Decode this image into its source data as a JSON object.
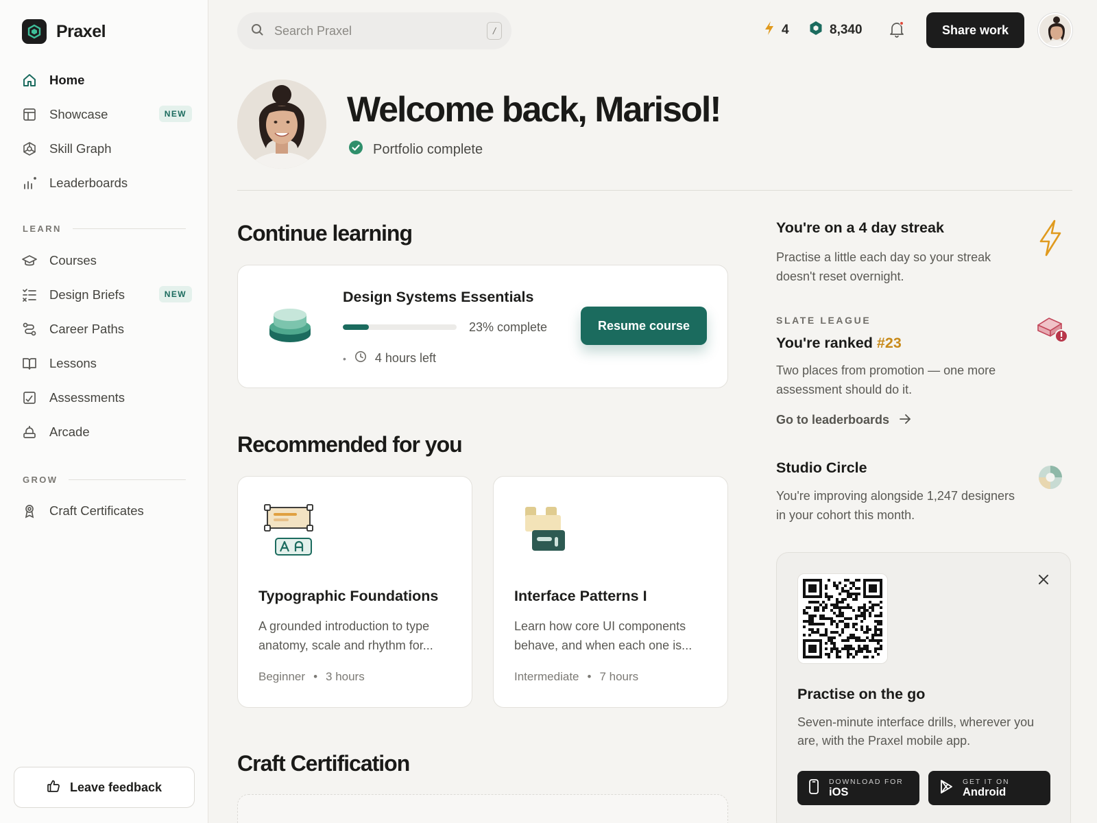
{
  "brand": {
    "name": "Praxel"
  },
  "sidebar": {
    "main_items": [
      {
        "label": "Home",
        "icon": "home-icon",
        "active": true
      },
      {
        "label": "Showcase",
        "icon": "layout-icon",
        "badge": "NEW"
      },
      {
        "label": "Skill Graph",
        "icon": "network-icon"
      },
      {
        "label": "Leaderboards",
        "icon": "bar-chart-icon"
      }
    ],
    "learn_label": "LEARN",
    "learn_items": [
      {
        "label": "Courses",
        "icon": "graduation-cap-icon"
      },
      {
        "label": "Design Briefs",
        "icon": "checklist-icon",
        "badge": "NEW"
      },
      {
        "label": "Career Paths",
        "icon": "route-icon"
      },
      {
        "label": "Lessons",
        "icon": "book-icon"
      },
      {
        "label": "Assessments",
        "icon": "assessment-icon"
      },
      {
        "label": "Arcade",
        "icon": "arcade-icon"
      }
    ],
    "grow_label": "GROW",
    "grow_items": [
      {
        "label": "Craft Certificates",
        "icon": "award-icon"
      }
    ],
    "feedback_label": "Leave feedback"
  },
  "topbar": {
    "search_placeholder": "Search Praxel",
    "search_shortcut": "/",
    "streak_count": "4",
    "gems_count": "8,340",
    "share_label": "Share work"
  },
  "hero": {
    "welcome": "Welcome back, Marisol!",
    "status": "Portfolio complete"
  },
  "continue": {
    "heading": "Continue learning",
    "course_title": "Design Systems Essentials",
    "progress_percent": 23,
    "progress_text": "23% complete",
    "time_left": "4 hours left",
    "resume_label": "Resume course"
  },
  "recommended": {
    "heading": "Recommended for you",
    "cards": [
      {
        "title": "Typographic Foundations",
        "desc": "A grounded introduction to type anatomy, scale and rhythm for...",
        "level": "Beginner",
        "duration": "3 hours"
      },
      {
        "title": "Interface Patterns I",
        "desc": "Learn how core UI components behave, and when each one is...",
        "level": "Intermediate",
        "duration": "7 hours"
      }
    ]
  },
  "certification": {
    "heading": "Craft Certification"
  },
  "streak": {
    "title": "You're on a 4 day streak",
    "text": "Practise a little each day so your streak doesn't reset overnight."
  },
  "league": {
    "label": "SLATE LEAGUE",
    "title_prefix": "You're ranked ",
    "rank": "#23",
    "text": "Two places from promotion — one more assessment should do it.",
    "link": "Go to leaderboards"
  },
  "circle": {
    "title": "Studio Circle",
    "text": "You're improving alongside 1,247 designers in your cohort this month."
  },
  "app_promo": {
    "title": "Practise on the go",
    "text": "Seven-minute interface drills, wherever you are, with the Praxel mobile app.",
    "ios_small": "DOWNLOAD FOR",
    "ios_big": "iOS",
    "android_small": "GET IT ON",
    "android_big": "Android"
  },
  "colors": {
    "accent": "#1b6b5e",
    "gold": "#c88a1a",
    "dark": "#1c1c1c"
  }
}
